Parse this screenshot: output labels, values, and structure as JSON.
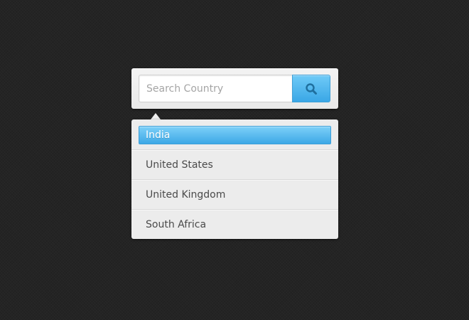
{
  "search": {
    "placeholder": "Search Country",
    "value": "",
    "button_icon": "search-icon"
  },
  "results": {
    "selected_index": 0,
    "items": [
      {
        "label": "India"
      },
      {
        "label": "United States"
      },
      {
        "label": "United Kingdom"
      },
      {
        "label": "South Africa"
      }
    ]
  },
  "colors": {
    "accent": "#3aa7e6",
    "panel_bg": "#ececec",
    "page_bg": "#242424"
  }
}
